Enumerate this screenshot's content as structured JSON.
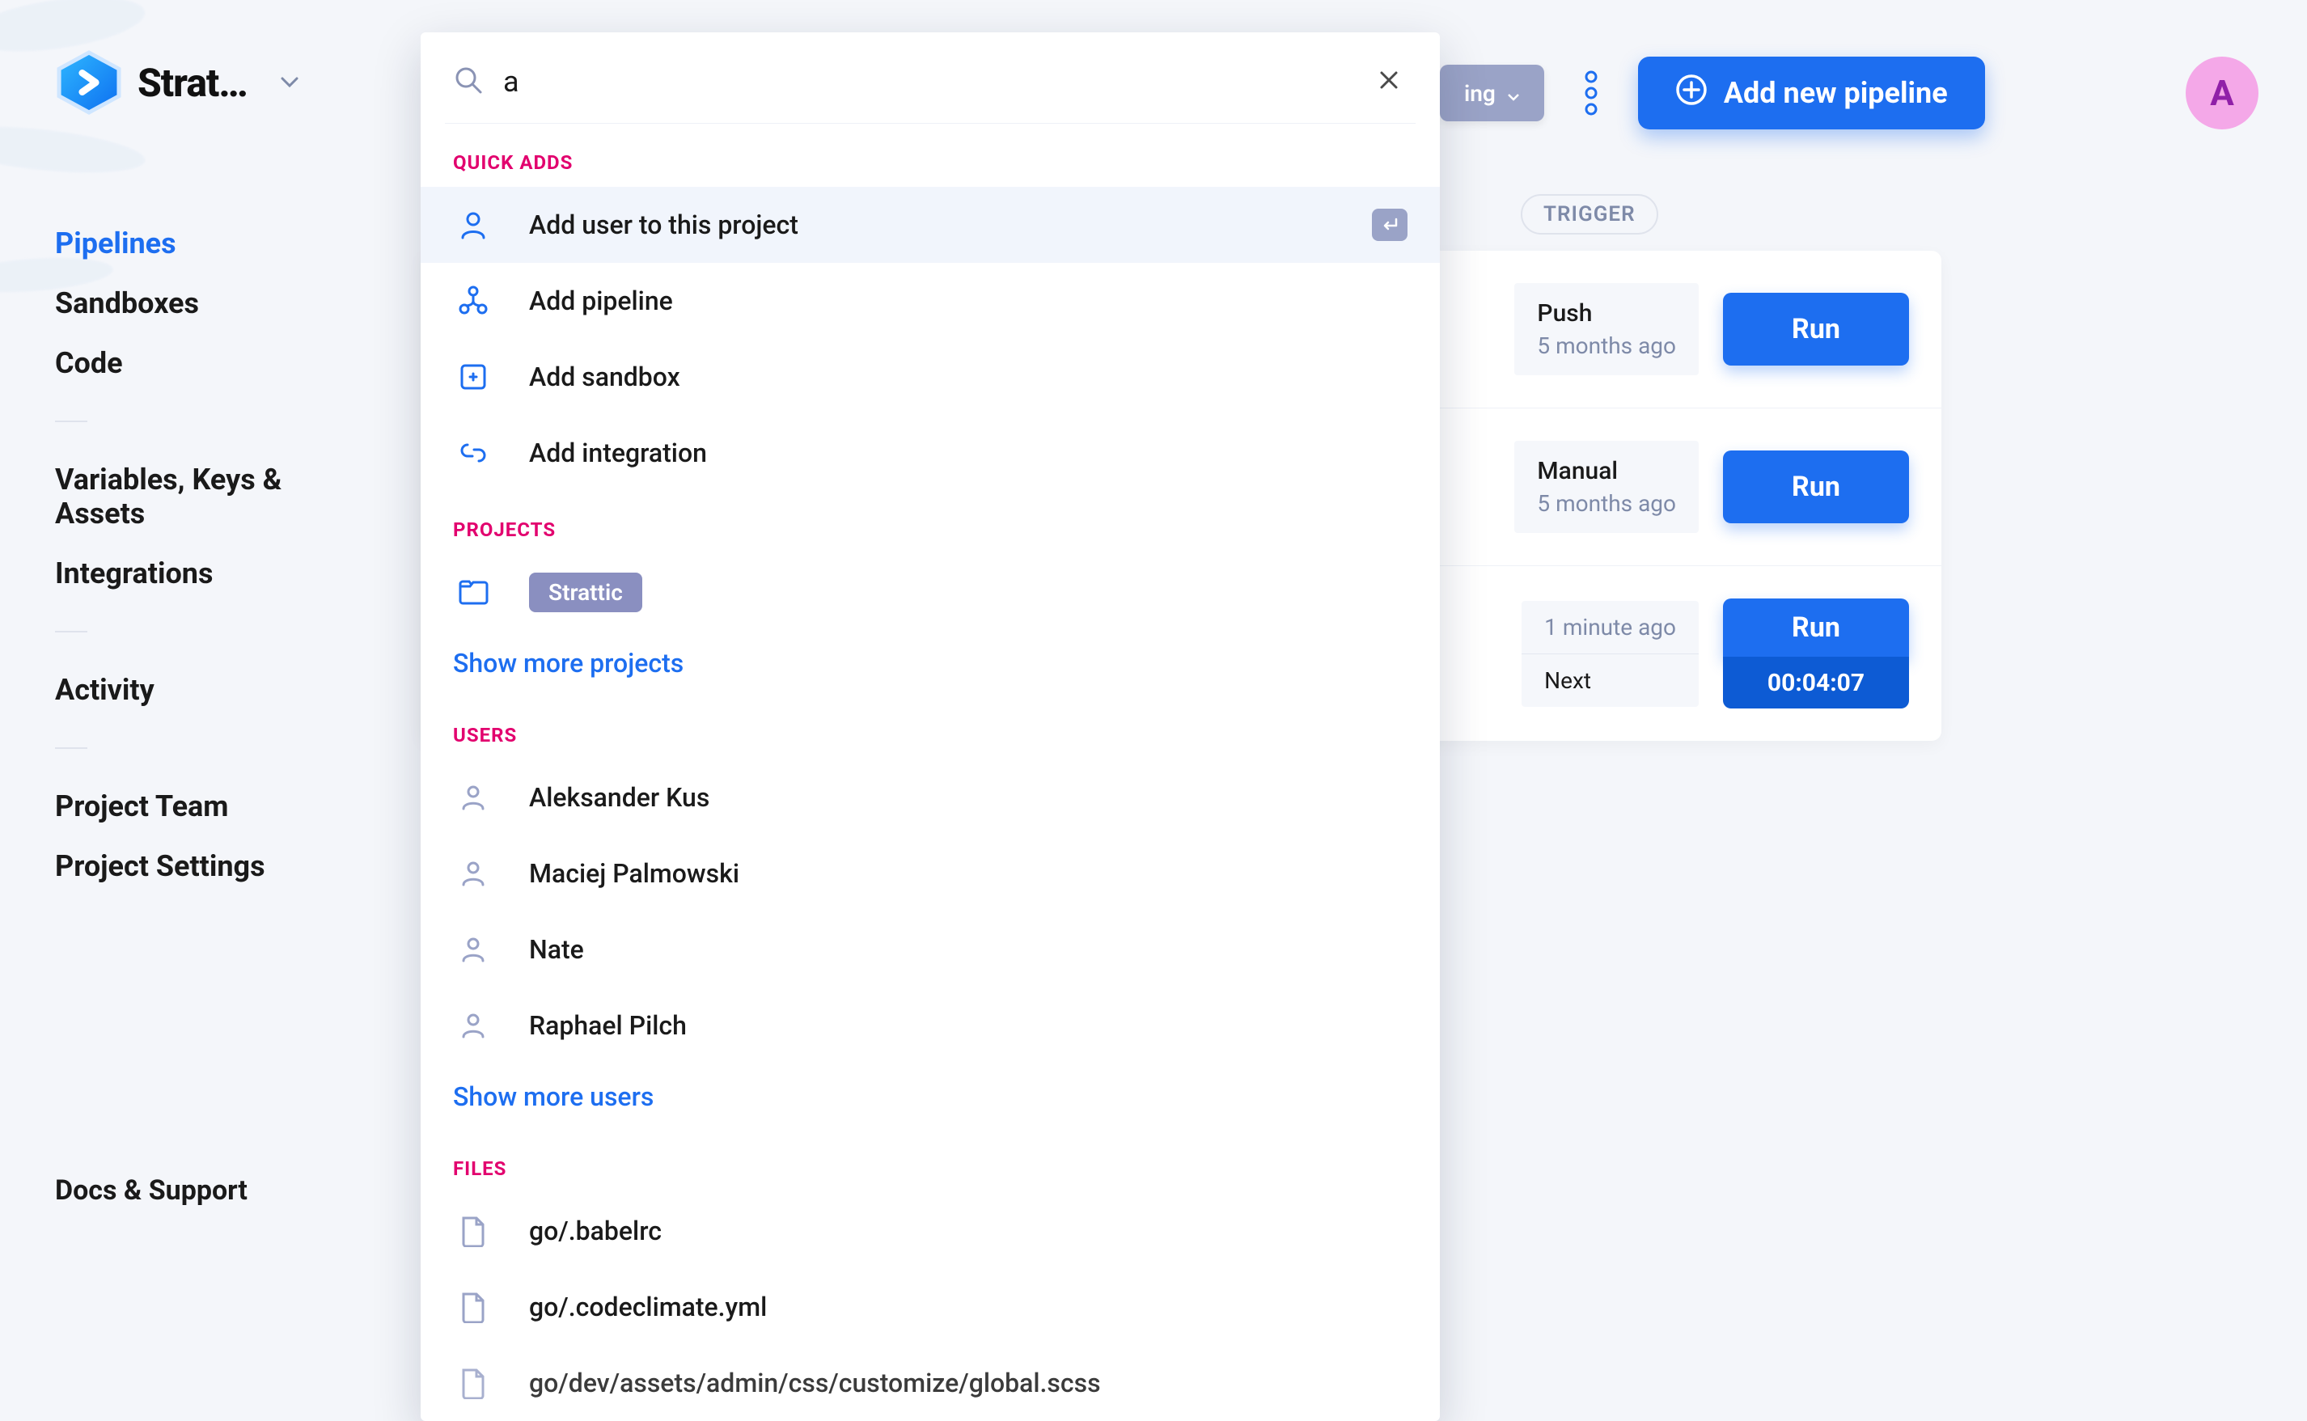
{
  "brand": {
    "name": "Strat…"
  },
  "sidebar": {
    "items": [
      {
        "label": "Pipelines",
        "active": true
      },
      {
        "label": "Sandboxes"
      },
      {
        "label": "Code"
      }
    ],
    "items2": [
      {
        "label": "Variables, Keys & Assets"
      },
      {
        "label": "Integrations"
      }
    ],
    "items3": [
      {
        "label": "Activity"
      }
    ],
    "items4": [
      {
        "label": "Project Team"
      },
      {
        "label": "Project Settings"
      }
    ],
    "docs": "Docs & Support"
  },
  "topbar": {
    "filter_tail": "ing",
    "add_pipeline": "Add new pipeline",
    "avatar_initial": "A"
  },
  "table": {
    "trigger_header": "TRIGGER",
    "rows": [
      {
        "line1": "Push",
        "line2": "5 months ago",
        "run": "Run"
      },
      {
        "line1": "Manual",
        "line2": "5 months ago",
        "run": "Run"
      },
      {
        "line1": "1 minute ago",
        "next": "Next",
        "run": "Run",
        "timer": "00:04:07"
      }
    ]
  },
  "search": {
    "query": "a",
    "quick_adds_label": "QUICK ADDS",
    "quick_adds": [
      "Add user to this project",
      "Add pipeline",
      "Add sandbox",
      "Add integration"
    ],
    "projects_label": "PROJECTS",
    "project_badge": "Strattic",
    "more_projects": "Show more projects",
    "users_label": "USERS",
    "users": [
      "Aleksander Kus",
      "Maciej Palmowski",
      "Nate",
      "Raphael Pilch"
    ],
    "more_users": "Show more users",
    "files_label": "FILES",
    "files": [
      "go/.babelrc",
      "go/.codeclimate.yml",
      "go/dev/assets/admin/css/customize/global.scss"
    ]
  }
}
